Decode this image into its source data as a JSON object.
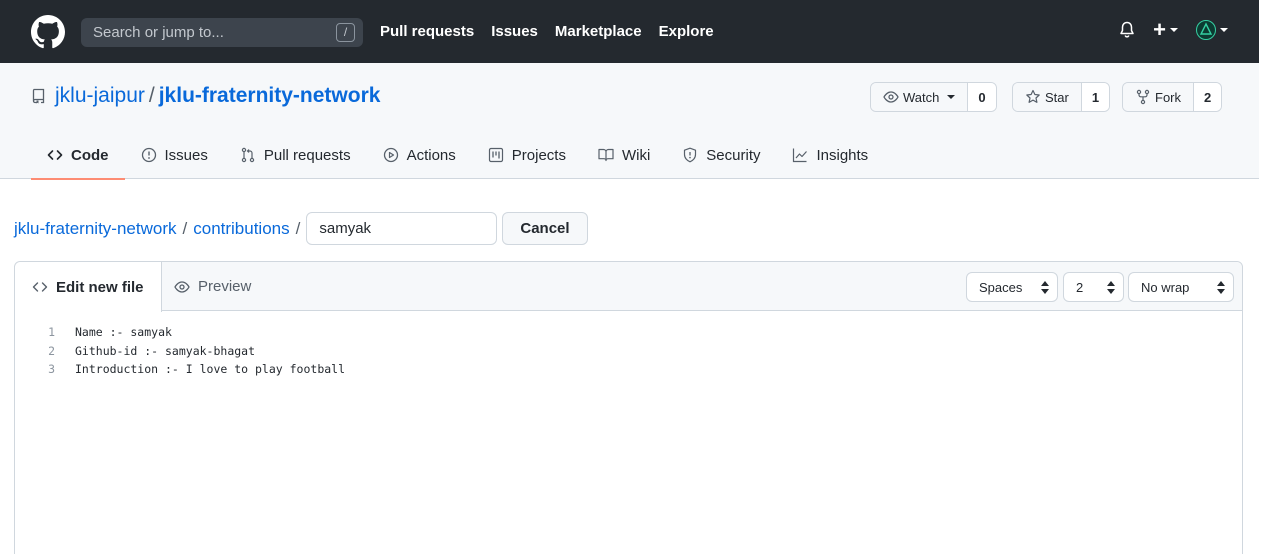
{
  "header": {
    "search_placeholder": "Search or jump to...",
    "search_shortcut": "/",
    "nav": [
      "Pull requests",
      "Issues",
      "Marketplace",
      "Explore"
    ],
    "plus_label": "+"
  },
  "repo": {
    "owner": "jklu-jaipur",
    "separator": "/",
    "name": "jklu-fraternity-network",
    "watch_label": "Watch",
    "watch_count": "0",
    "star_label": "Star",
    "star_count": "1",
    "fork_label": "Fork",
    "fork_count": "2"
  },
  "tabs": [
    {
      "label": "Code",
      "icon": "code-icon",
      "active": true
    },
    {
      "label": "Issues",
      "icon": "issue-icon"
    },
    {
      "label": "Pull requests",
      "icon": "pull-request-icon"
    },
    {
      "label": "Actions",
      "icon": "play-icon"
    },
    {
      "label": "Projects",
      "icon": "project-icon"
    },
    {
      "label": "Wiki",
      "icon": "book-icon"
    },
    {
      "label": "Security",
      "icon": "shield-icon"
    },
    {
      "label": "Insights",
      "icon": "graph-icon"
    }
  ],
  "breadcrumb": {
    "repo_link": "jklu-fraternity-network",
    "sep": "/",
    "folder_link": "contributions",
    "filename_value": "samyak",
    "cancel_label": "Cancel"
  },
  "editor": {
    "edit_tab": "Edit new file",
    "preview_tab": "Preview",
    "indent_mode": "Spaces",
    "indent_size": "2",
    "wrap_mode": "No wrap",
    "lines": [
      {
        "num": "1",
        "text": "Name :- samyak"
      },
      {
        "num": "2",
        "text": "Github-id :- samyak-bhagat"
      },
      {
        "num": "3",
        "text": "Introduction :- I love to play football"
      }
    ]
  },
  "colors": {
    "header_bg": "#24292f",
    "link": "#0969da",
    "active_tab_underline": "#fd8c73",
    "subtle_bg": "#f6f8fa",
    "border": "#d0d7de"
  }
}
